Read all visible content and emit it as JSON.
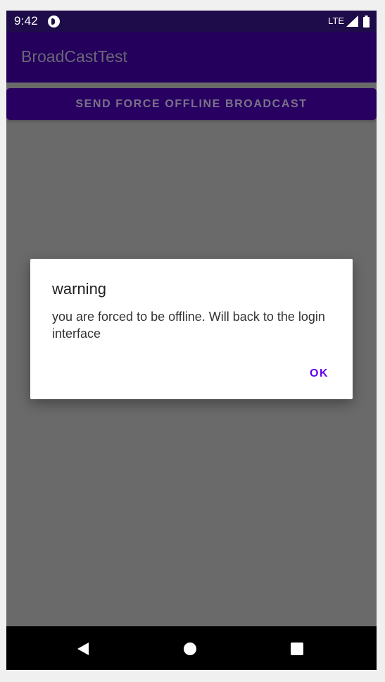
{
  "status_bar": {
    "time": "9:42",
    "network": "LTE",
    "icons": [
      "app-notification-icon",
      "signal-icon",
      "battery-icon"
    ]
  },
  "app_bar": {
    "title": "BroadCastTest"
  },
  "main": {
    "send_button_label": "SEND FORCE OFFLINE BROADCAST"
  },
  "dialog": {
    "title": "warning",
    "message": "you are forced to be offline. Will back to the login interface",
    "ok_label": "OK"
  },
  "nav_bar": {
    "icons": [
      "back-icon",
      "home-icon",
      "recents-icon"
    ]
  },
  "colors": {
    "status_bar": "#1e0b4a",
    "app_bar": "#24005c",
    "button": "#280062",
    "scrim_background": "#6a6a6a",
    "dialog_accent": "#6200ee"
  }
}
